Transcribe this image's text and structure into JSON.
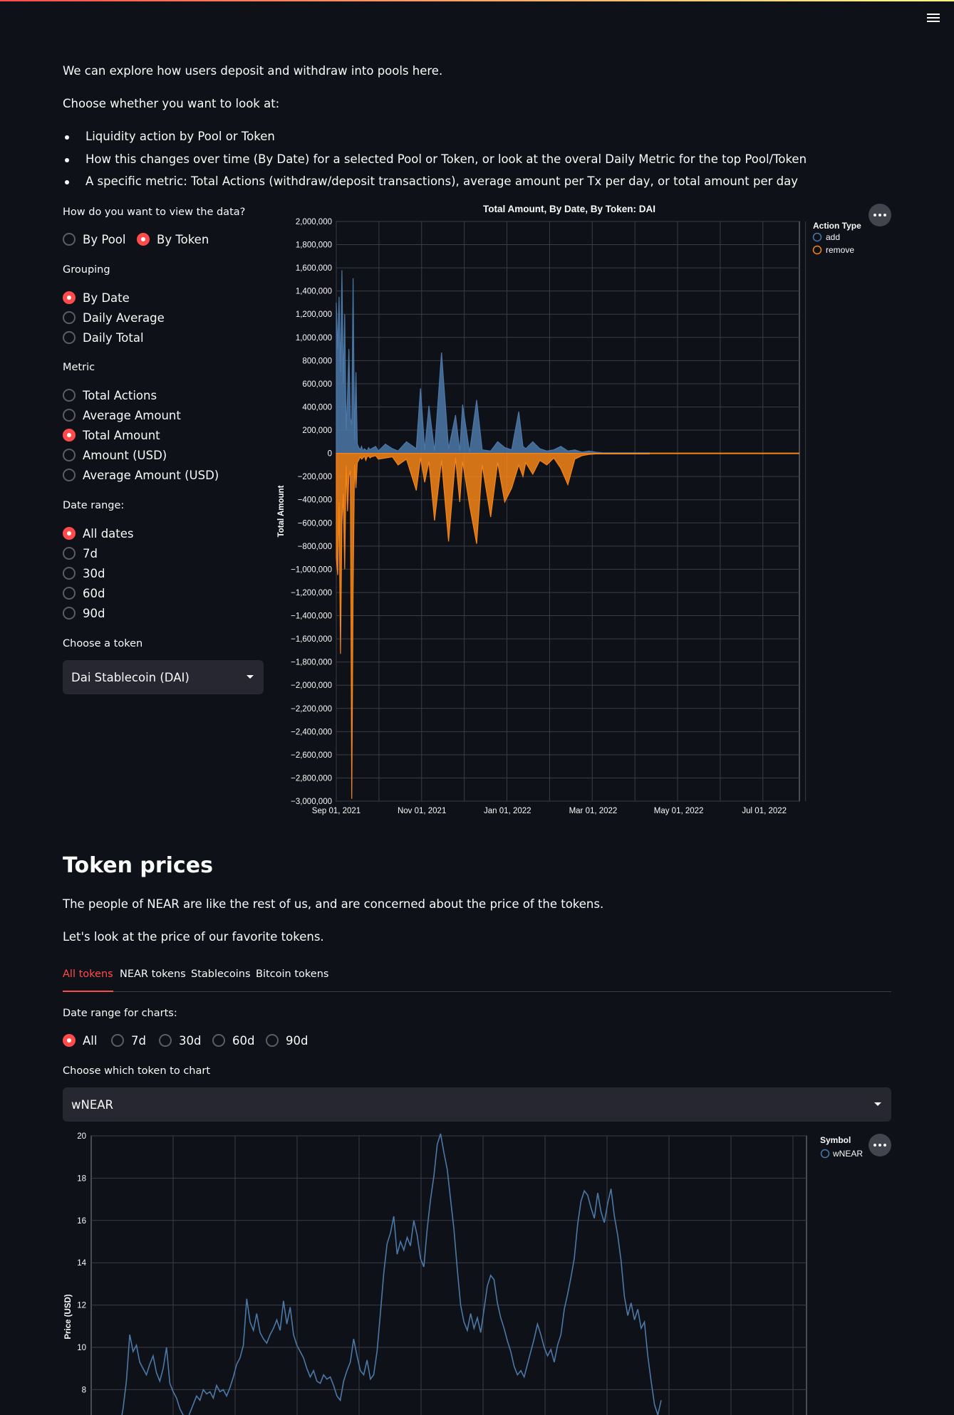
{
  "intro": {
    "line1": "We can explore how users deposit and withdraw into pools here.",
    "line2": "Choose whether you want to look at:",
    "bullets": [
      "Liquidity action by Pool or Token",
      "How this changes over time (By Date) for a selected Pool or Token, or look at the overal Daily Metric for the top Pool/Token",
      "A specific metric: Total Actions (withdraw/deposit transactions), average amount per Tx per day, or total amount per day"
    ]
  },
  "controls": {
    "view": {
      "label": "How do you want to view the data?",
      "options": [
        "By Pool",
        "By Token"
      ],
      "selected": "By Token"
    },
    "grouping": {
      "label": "Grouping",
      "options": [
        "By Date",
        "Daily Average",
        "Daily Total"
      ],
      "selected": "By Date"
    },
    "metric": {
      "label": "Metric",
      "options": [
        "Total Actions",
        "Average Amount",
        "Total Amount",
        "Amount (USD)",
        "Average Amount (USD)"
      ],
      "selected": "Total Amount"
    },
    "date_range": {
      "label": "Date range:",
      "options": [
        "All dates",
        "7d",
        "30d",
        "60d",
        "90d"
      ],
      "selected": "All dates"
    },
    "token": {
      "label": "Choose a token",
      "value": "Dai Stablecoin (DAI)"
    }
  },
  "token_prices": {
    "title": "Token prices",
    "p1": "The people of NEAR are like the rest of us, and are concerned about the price of the tokens.",
    "p2": "Let's look at the price of our favorite tokens.",
    "tabs": [
      "All tokens",
      "NEAR tokens",
      "Stablecoins",
      "Bitcoin tokens"
    ],
    "active_tab": "All tokens",
    "date_range": {
      "label": "Date range for charts:",
      "options": [
        "All",
        "7d",
        "30d",
        "60d",
        "90d"
      ],
      "selected": "All"
    },
    "token_select": {
      "label": "Choose which token to chart",
      "value": "wNEAR"
    }
  },
  "chart_data": [
    {
      "type": "area",
      "title": "Total Amount, By Date, By Token: DAI",
      "xlabel": "",
      "ylabel": "Total Amount",
      "ylim": [
        -3000000,
        2000000
      ],
      "x_ticks": [
        "Sep 01, 2021",
        "Nov 01, 2021",
        "Jan 01, 2022",
        "Mar 01, 2022",
        "May 01, 2022",
        "Jul 01, 2022"
      ],
      "y_ticks": [
        "2,000,000",
        "1,800,000",
        "1,600,000",
        "1,400,000",
        "1,200,000",
        "1,000,000",
        "800,000",
        "600,000",
        "400,000",
        "200,000",
        "0",
        "−200,000",
        "−400,000",
        "−600,000",
        "−800,000",
        "−1,000,000",
        "−1,200,000",
        "−1,400,000",
        "−1,600,000",
        "−1,800,000",
        "−2,000,000",
        "−2,200,000",
        "−2,400,000",
        "−2,600,000",
        "−2,800,000",
        "−3,000,000"
      ],
      "legend_title": "Action Type",
      "legend_position": "right",
      "colors": {
        "add": "#4c78a8",
        "remove": "#f58518"
      },
      "series": [
        {
          "name": "add",
          "x": [
            0,
            1,
            2,
            3,
            4,
            5,
            6,
            7,
            8,
            9,
            10,
            11,
            12,
            13,
            14,
            15,
            16,
            17,
            18,
            19,
            20,
            21,
            22,
            23,
            24,
            25,
            28,
            30,
            35,
            40,
            44,
            50,
            57,
            60,
            63,
            66,
            70,
            75,
            80,
            85,
            88,
            90,
            95,
            100,
            104,
            110,
            115,
            120,
            125,
            130,
            133,
            135,
            140,
            145,
            150,
            155,
            160,
            165,
            170,
            175,
            180,
            185,
            190,
            195,
            200,
            210,
            220,
            223
          ],
          "values": [
            1300000,
            900000,
            1350000,
            700000,
            1580000,
            600000,
            1200000,
            200000,
            500000,
            900000,
            300000,
            250000,
            1510000,
            120000,
            700000,
            80000,
            50000,
            30000,
            60000,
            20000,
            40000,
            30000,
            20000,
            50000,
            30000,
            40000,
            60000,
            20000,
            80000,
            40000,
            20000,
            100000,
            40000,
            560000,
            30000,
            410000,
            20000,
            870000,
            40000,
            330000,
            20000,
            420000,
            10000,
            460000,
            30000,
            20000,
            100000,
            50000,
            30000,
            360000,
            60000,
            40000,
            100000,
            40000,
            20000,
            30000,
            60000,
            20000,
            30000,
            10000,
            20000,
            10000,
            5000,
            5000,
            5000,
            5000,
            5000,
            5000
          ]
        },
        {
          "name": "remove",
          "x": [
            0,
            1,
            2,
            3,
            4,
            5,
            6,
            7,
            8,
            9,
            10,
            11,
            12,
            13,
            14,
            15,
            16,
            17,
            18,
            19,
            20,
            21,
            22,
            23,
            24,
            25,
            28,
            30,
            35,
            40,
            44,
            50,
            57,
            60,
            63,
            66,
            70,
            75,
            80,
            85,
            88,
            90,
            95,
            100,
            104,
            110,
            115,
            120,
            125,
            130,
            133,
            135,
            140,
            145,
            150,
            155,
            160,
            165,
            170,
            175,
            180,
            185,
            190,
            195,
            200,
            210,
            220,
            223
          ],
          "values": [
            -900000,
            -1050000,
            -420000,
            -1730000,
            -600000,
            -350000,
            -1000000,
            -100000,
            -500000,
            -200000,
            -150000,
            -2980000,
            -1200000,
            -100000,
            -300000,
            -80000,
            -60000,
            -30000,
            -50000,
            -40000,
            -20000,
            -60000,
            -30000,
            -20000,
            -40000,
            -30000,
            -20000,
            -50000,
            -40000,
            -30000,
            -100000,
            -50000,
            -320000,
            -40000,
            -250000,
            -70000,
            -580000,
            -60000,
            -760000,
            -40000,
            -420000,
            -70000,
            -450000,
            -780000,
            -100000,
            -550000,
            -80000,
            -420000,
            -300000,
            -100000,
            -200000,
            -80000,
            -180000,
            -60000,
            -100000,
            -40000,
            -130000,
            -270000,
            -50000,
            -20000,
            -10000,
            -5000,
            -5000,
            -5000,
            -5000,
            -5000,
            -5000,
            -5000
          ]
        }
      ]
    },
    {
      "type": "line",
      "title": "",
      "xlabel": "",
      "ylabel": "Price (USD)",
      "ylim_visible": [
        7,
        20
      ],
      "y_ticks": [
        8,
        10,
        12,
        14,
        16,
        18,
        20
      ],
      "legend_title": "Symbol",
      "series": [
        {
          "name": "wNEAR",
          "color": "#4c78a8",
          "values": [
            6.2,
            7.1,
            8.4,
            10.6,
            9.8,
            10.1,
            9.3,
            9.0,
            8.7,
            9.2,
            9.6,
            8.8,
            8.4,
            9.0,
            10.0,
            8.3,
            7.9,
            7.6,
            7.1,
            6.8,
            6.5,
            6.9,
            7.3,
            7.7,
            7.5,
            8.0,
            7.8,
            7.9,
            7.6,
            8.2,
            7.9,
            8.0,
            7.7,
            8.1,
            8.6,
            9.2,
            9.5,
            10.1,
            12.3,
            11.2,
            10.8,
            11.6,
            10.7,
            10.4,
            10.2,
            10.6,
            10.9,
            11.3,
            10.8,
            12.2,
            11.1,
            11.9,
            10.6,
            10.1,
            9.8,
            9.5,
            9.0,
            8.6,
            8.9,
            8.4,
            8.3,
            8.7,
            8.5,
            8.6,
            8.2,
            7.7,
            7.5,
            8.4,
            8.9,
            9.3,
            10.4,
            9.6,
            8.9,
            8.7,
            9.4,
            8.5,
            8.7,
            9.8,
            11.6,
            13.5,
            14.9,
            15.4,
            16.2,
            14.4,
            15.0,
            14.6,
            15.2,
            14.8,
            16.0,
            15.3,
            14.2,
            13.8,
            15.6,
            17.0,
            18.1,
            19.6,
            20.1,
            19.2,
            18.4,
            17.0,
            15.6,
            13.7,
            12.0,
            11.2,
            10.8,
            11.6,
            10.9,
            11.4,
            10.7,
            11.8,
            12.9,
            13.4,
            13.2,
            12.1,
            11.4,
            10.9,
            10.3,
            9.8,
            9.1,
            8.7,
            8.9,
            8.6,
            9.2,
            9.8,
            10.4,
            11.1,
            10.6,
            10.0,
            9.6,
            9.9,
            9.3,
            10.1,
            10.6,
            11.8,
            12.5,
            13.3,
            14.2,
            15.8,
            16.9,
            17.4,
            17.2,
            16.6,
            16.1,
            17.3,
            16.4,
            15.9,
            16.8,
            17.5,
            16.2,
            15.3,
            14.1,
            12.4,
            11.5,
            12.1,
            11.3,
            11.8,
            10.9,
            11.2,
            9.6,
            8.4,
            7.3,
            6.8,
            7.5
          ]
        }
      ]
    }
  ]
}
